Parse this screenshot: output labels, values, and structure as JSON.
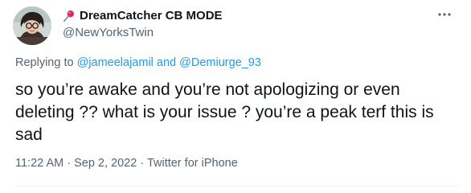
{
  "author": {
    "display_name": "DreamCatcher CB MODE",
    "handle": "@NewYorksTwin",
    "name_emoji_icon": "pushpin-icon",
    "avatar_icon": "avatar"
  },
  "reply": {
    "prefix": "Replying to ",
    "mentions": [
      "@jameelajamil",
      "@Demiurge_93"
    ],
    "joiner": " and "
  },
  "tweet": {
    "text": "so you’re awake and you’re not apologizing or even deleting ?? what is your issue ? you’re a peak terf this is sad"
  },
  "meta": {
    "time": "11:22 AM",
    "separator": " · ",
    "date": "Sep 2, 2022",
    "source": "Twitter for iPhone"
  },
  "colors": {
    "text": "#0f1419",
    "secondary": "#536471",
    "link": "#1d9bf0",
    "pin": "#e0245e"
  }
}
